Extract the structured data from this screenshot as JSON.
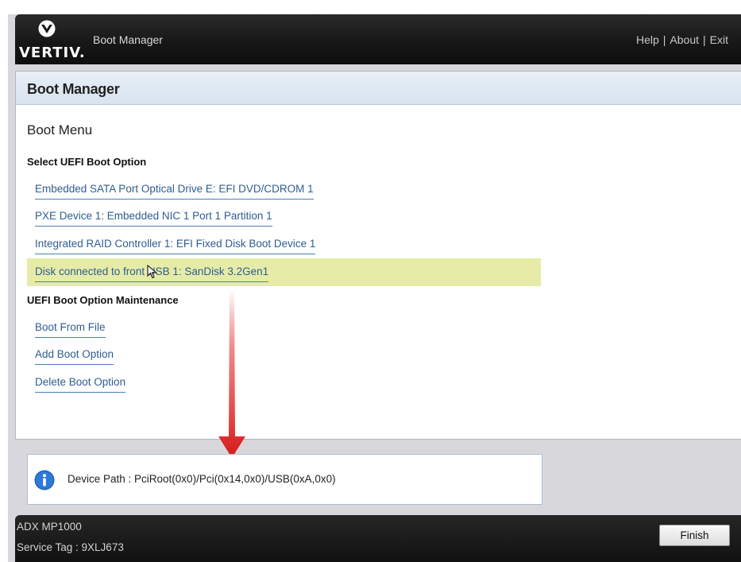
{
  "header": {
    "brand": "VERTIV.",
    "title": "Boot Manager",
    "links": [
      "Help",
      "About",
      "Exit"
    ]
  },
  "panel": {
    "title": "Boot Manager",
    "section": "Boot Menu",
    "uefi_boot_options_label": "Select UEFI Boot Option",
    "boot_options": [
      "Embedded SATA Port Optical Drive E: EFI DVD/CDROM 1",
      "PXE Device 1: Embedded NIC 1 Port 1 Partition 1",
      "Integrated RAID Controller 1: EFI Fixed Disk Boot Device 1",
      "Disk connected to front USB 1:  SanDisk 3.2Gen1"
    ],
    "selected_index": 3,
    "maintenance_label": "UEFI Boot Option Maintenance",
    "maintenance_options": [
      "Boot From File",
      "Add Boot Option",
      "Delete Boot Option"
    ]
  },
  "info": {
    "icon": "info-icon",
    "text": "Device Path : PciRoot(0x0)/Pci(0x14,0x0)/USB(0xA,0x0)"
  },
  "footer": {
    "model": "ADX MP1000",
    "service_tag": "Service Tag : 9XLJ673",
    "finish_label": "Finish"
  },
  "colors": {
    "header_bg": "#161616",
    "link": "#2f5d8f",
    "highlight": "#e6eca8",
    "arrow": "#d81a1a"
  }
}
